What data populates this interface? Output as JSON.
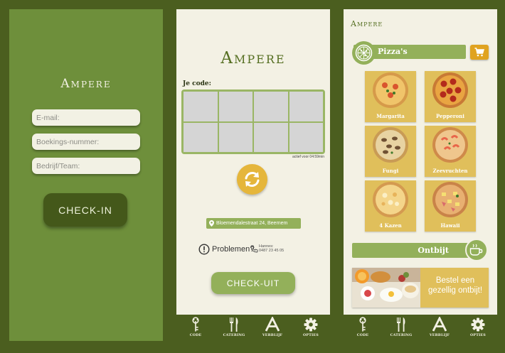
{
  "colors": {
    "background": "#4b5e1f",
    "green_panel": "#6e8f3b",
    "dark_green": "#44581a",
    "light_green": "#93b05a",
    "cream": "#f3f1e4",
    "mustard": "#e0bf5b",
    "orange": "#e5b63b"
  },
  "checkin": {
    "brand": "Ampere",
    "email_placeholder": "E-mail:",
    "booking_placeholder": "Boekings-nummer:",
    "company_placeholder": "Bedrijf/Team:",
    "button_label": "CHECK-IN"
  },
  "code_screen": {
    "brand": "Ampere",
    "code_label": "Je code:",
    "active_text": "actief voor 04:59min",
    "refresh_icon": "refresh-icon",
    "address": "Bloemendalestraat 24, Beernem",
    "problems_label": "Problemen?",
    "contact_name": "Hannes:",
    "contact_phone": "0487 23 45 05",
    "button_label": "CHECK-UIT"
  },
  "nav": {
    "items": [
      {
        "icon": "key-icon",
        "label": "CODE"
      },
      {
        "icon": "fork-knife-icon",
        "label": "CATERING"
      },
      {
        "icon": "ampere-logo-icon",
        "label": "VERBLIJF"
      },
      {
        "icon": "gear-icon",
        "label": "OPTIES"
      }
    ]
  },
  "menu_screen": {
    "brand": "Ampere",
    "category_label": "Pizza's",
    "category_icon": "pizza-icon",
    "cart_icon": "cart-icon",
    "pizzas": [
      {
        "name": "Margarita"
      },
      {
        "name": "Pepperoni"
      },
      {
        "name": "Fungi"
      },
      {
        "name": "Zeevruchten"
      },
      {
        "name": "4 Kazen"
      },
      {
        "name": "Hawaii"
      }
    ],
    "breakfast_label": "Ontbijt",
    "breakfast_icon": "coffee-cup-icon",
    "promo_text": "Bestel een gezellig ontbijt!"
  }
}
